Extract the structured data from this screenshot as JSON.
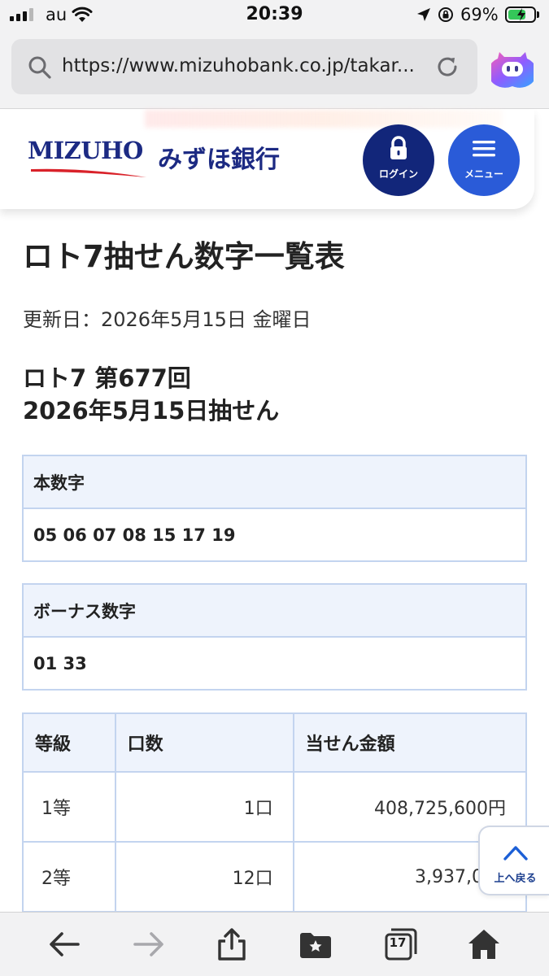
{
  "status_bar": {
    "carrier": "au",
    "time": "20:39",
    "battery_percent": "69%",
    "battery_level": 0.69,
    "icons": [
      "signal-icon",
      "wifi-icon",
      "location-arrow-icon",
      "orientation-lock-icon",
      "battery-charging-icon"
    ]
  },
  "browser": {
    "url": "https://www.mizuhobank.co.jp/takar...",
    "icons": [
      "search-icon",
      "reload-icon",
      "assistant-icon"
    ]
  },
  "site_header": {
    "logo_en": "MIZUHO",
    "logo_ja": "みずほ銀行",
    "login_label": "ログイン",
    "menu_label": "メニュー",
    "brand_color": "#1c2a83",
    "login_color": "#12267a",
    "menu_color": "#2a5bd8"
  },
  "main": {
    "page_title": "ロト7抽せん数字一覧表",
    "updated": "更新日：2026年5月15日 金曜日",
    "draw_title_line1": "ロト7 第677回",
    "draw_title_line2": "2026年5月15日抽せん",
    "main_numbers_label": "本数字",
    "main_numbers": "05 06 07 08 15 17 19",
    "bonus_numbers_label": "ボーナス数字",
    "bonus_numbers": "01 33",
    "prize_table": {
      "headers": [
        "等級",
        "口数",
        "当せん金額"
      ],
      "rows": [
        {
          "grade": "1等",
          "count": "1口",
          "amount": "408,725,600円"
        },
        {
          "grade": "2等",
          "count": "12口",
          "amount": "3,937,000"
        }
      ]
    },
    "table_border_color": "#c3d4ef",
    "table_header_bg": "#eef3fc"
  },
  "back_to_top": {
    "label": "上へ戻る",
    "icon": "chevron-up-icon"
  },
  "toolbar": {
    "tab_count": "17",
    "icons": [
      "back-arrow-icon",
      "forward-arrow-icon",
      "share-icon",
      "bookmarks-icon",
      "tabs-icon",
      "home-icon"
    ]
  }
}
